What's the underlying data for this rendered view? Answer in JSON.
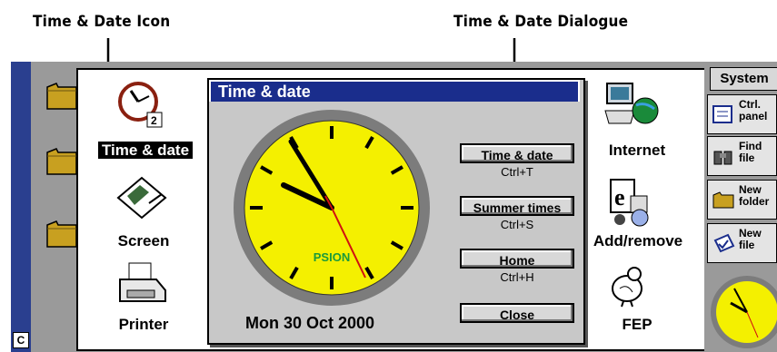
{
  "callouts": {
    "left": "Time & Date Icon",
    "right": "Time & Date Dialogue"
  },
  "control_panel_left": {
    "items": [
      {
        "label": "Time & date",
        "selected": true
      },
      {
        "label": "Screen"
      },
      {
        "label": "Printer"
      }
    ]
  },
  "control_panel_right": {
    "items": [
      {
        "label": "Internet"
      },
      {
        "label": "Add/remove"
      },
      {
        "label": "FEP"
      }
    ]
  },
  "dialog": {
    "title": "Time & date",
    "clock_brand": "PSION",
    "date": "Mon 30 Oct 2000",
    "buttons": [
      {
        "label": "Time & date",
        "shortcut": "Ctrl+T"
      },
      {
        "label": "Summer times",
        "shortcut": "Ctrl+S"
      },
      {
        "label": "Home",
        "shortcut": "Ctrl+H"
      },
      {
        "label": "Close",
        "shortcut": ""
      }
    ]
  },
  "sidebar": {
    "title": "System",
    "buttons": [
      {
        "line1": "Ctrl.",
        "line2": "panel",
        "icon": "control-panel-icon"
      },
      {
        "line1": "Find",
        "line2": "file",
        "icon": "binoculars-icon"
      },
      {
        "line1": "New",
        "line2": "folder",
        "icon": "folder-icon"
      },
      {
        "line1": "New",
        "line2": "file",
        "icon": "new-file-icon"
      }
    ]
  },
  "status": {
    "c_button": "C"
  },
  "colors": {
    "clock_face": "#f4f000",
    "titlebar": "#1a2d8c",
    "brand": "#1a9a3a"
  }
}
